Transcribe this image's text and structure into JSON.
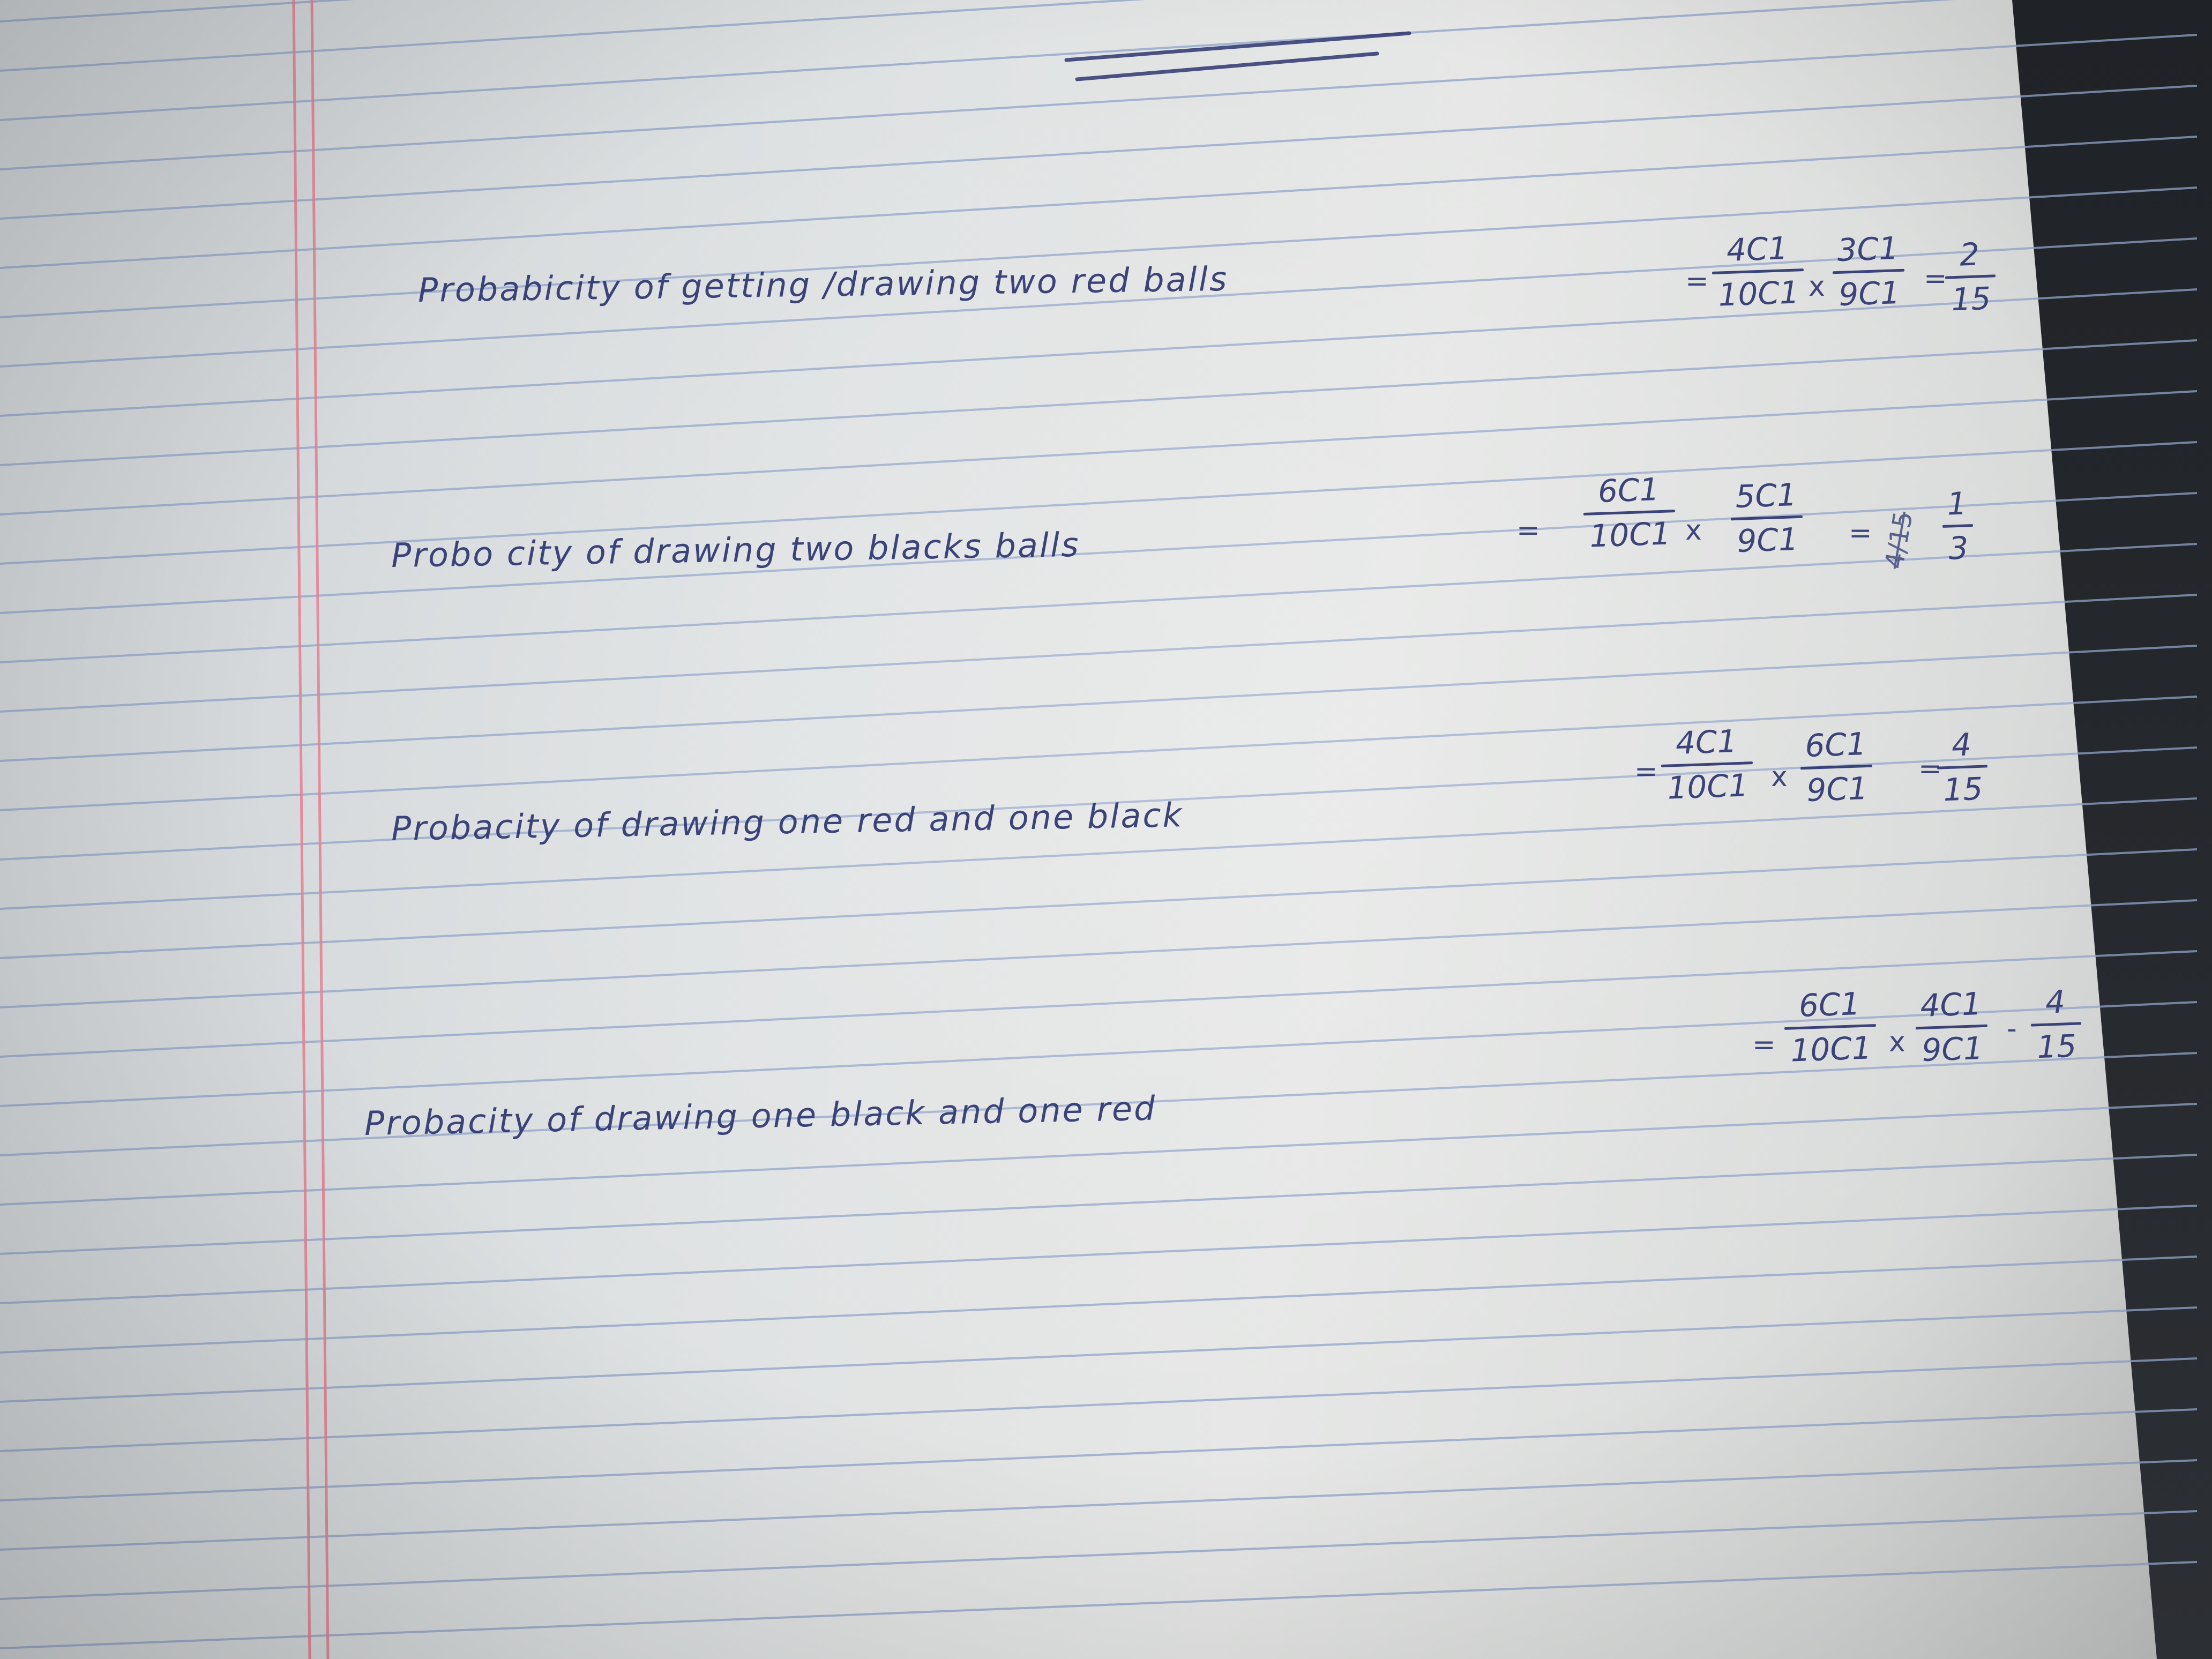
{
  "notes": {
    "lines": [
      {
        "label": "Probabicity of getting /drawing two red balls",
        "equals": "=",
        "terms": [
          {
            "num": "4C1",
            "den": "10C1"
          },
          {
            "num": "3C1",
            "den": "9C1"
          }
        ],
        "times": "x",
        "result_equals": "=",
        "result": {
          "num": "2",
          "den": "15"
        }
      },
      {
        "label": "Probo city of drawing two blacks balls",
        "equals": "=",
        "terms": [
          {
            "num": "6C1",
            "den": "10C1"
          },
          {
            "num": "5C1",
            "den": "9C1"
          }
        ],
        "times": "x",
        "result_equals": "=",
        "struck": "4/15",
        "result": {
          "num": "1",
          "den": "3"
        }
      },
      {
        "label": "Probacity of drawing one red and one black",
        "equals": "=",
        "terms": [
          {
            "num": "4C1",
            "den": "10C1"
          },
          {
            "num": "6C1",
            "den": "9C1"
          }
        ],
        "times": "x",
        "result_equals": "=",
        "result": {
          "num": "4",
          "den": "15"
        }
      },
      {
        "label": "Probacity of drawing one black and one red",
        "equals": "=",
        "terms": [
          {
            "num": "6C1",
            "den": "10C1"
          },
          {
            "num": "4C1",
            "den": "9C1"
          }
        ],
        "times": "x",
        "result_equals": "-",
        "result": {
          "num": "4",
          "den": "15"
        }
      }
    ]
  },
  "colors": {
    "ink": "#2e3670",
    "rule_line": "#8fa3c8",
    "margin_line": "#e57f93",
    "paper": "#e2e4e3"
  }
}
